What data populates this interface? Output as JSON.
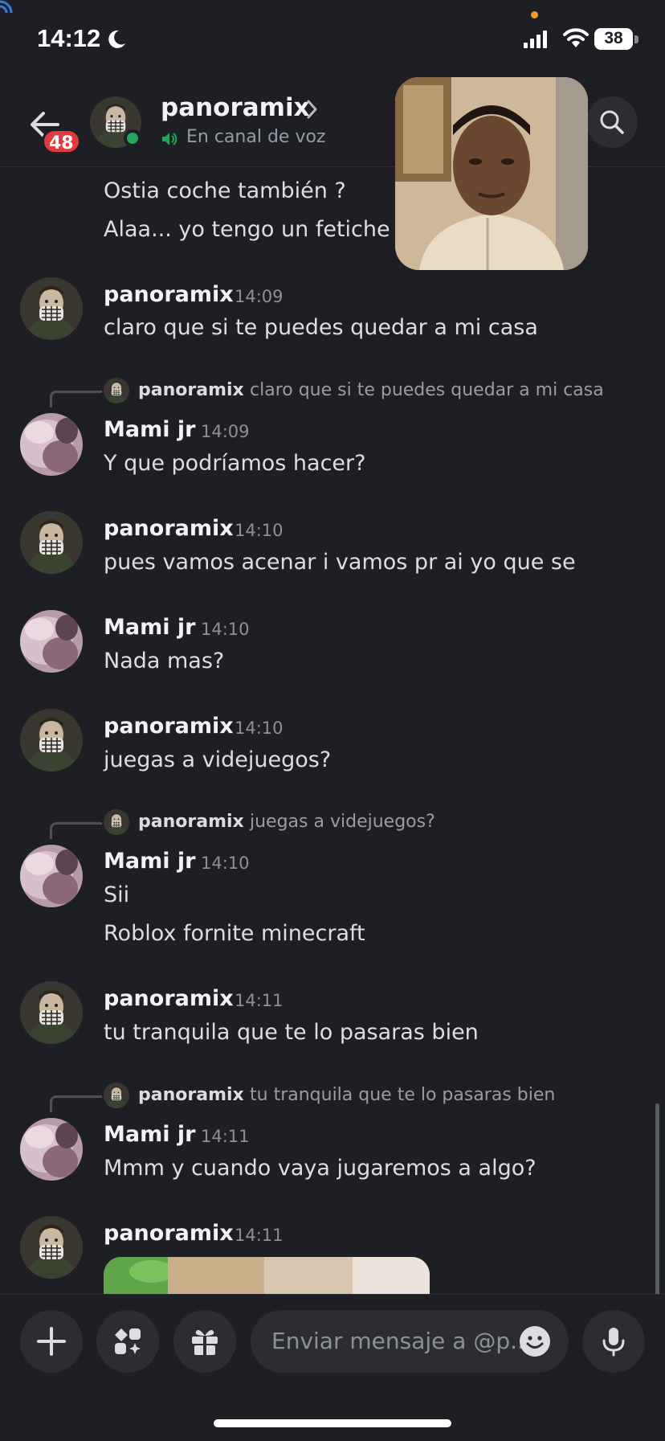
{
  "status_bar": {
    "time": "14:12",
    "battery": "38"
  },
  "header": {
    "back_badge": "48",
    "name": "panoramix",
    "subtitle": "En canal de voz"
  },
  "chat": {
    "lines": {
      "l1": "Ostia coche también ?",
      "l2": "Alaa... yo tengo un fetiche"
    },
    "messages": [
      {
        "author": "panoramix",
        "time": "14:09",
        "lines": [
          "claro que  si te puedes quedar a mi casa"
        ]
      },
      {
        "reply_author": "panoramix",
        "reply_text": "claro que  si te puedes quedar a mi casa",
        "author": "Mami jr",
        "time": "14:09",
        "lines": [
          "Y que podríamos hacer?"
        ]
      },
      {
        "author": "panoramix",
        "time": "14:10",
        "lines": [
          "pues vamos acenar i vamos pr ai yo que se"
        ]
      },
      {
        "author": "Mami jr",
        "time": "14:10",
        "lines": [
          "Nada mas?"
        ]
      },
      {
        "author": "panoramix",
        "time": "14:10",
        "lines": [
          "juegas a videjuegos?"
        ]
      },
      {
        "reply_author": "panoramix",
        "reply_text": "juegas a videjuegos?",
        "author": "Mami jr",
        "time": "14:10",
        "lines": [
          "Sii",
          "Roblox fornite minecraft"
        ]
      },
      {
        "author": "panoramix",
        "time": "14:11",
        "lines": [
          "tu tranquila que te lo pasaras bien"
        ]
      },
      {
        "reply_author": "panoramix",
        "reply_text": "tu tranquila que te lo pasaras bien",
        "author": "Mami jr",
        "time": "14:11",
        "lines": [
          "Mmm y cuando vaya jugaremos a algo?"
        ]
      },
      {
        "author": "panoramix",
        "time": "14:11",
        "lines": []
      }
    ]
  },
  "composer": {
    "placeholder": "Enviar mensaje a @p.."
  },
  "icons": {
    "back": "arrow-left-icon",
    "search": "search-icon",
    "add": "plus-icon",
    "apps": "apps-icon",
    "gift": "gift-icon",
    "emoji": "emoji-icon",
    "mic": "microphone-icon",
    "voice": "speaker-icon"
  },
  "colors": {
    "background": "#1e1f25",
    "online": "#23a55a",
    "badge": "#e5393e"
  }
}
